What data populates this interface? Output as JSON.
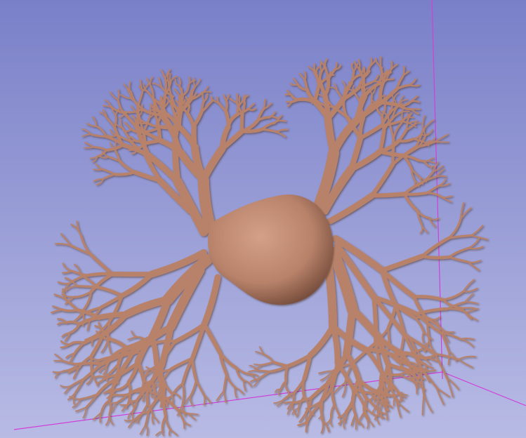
{
  "viewer": {
    "background_top": "#7A80C8",
    "background_bottom": "#B8BBE4",
    "bounding_box_color": "#D040D8"
  },
  "model": {
    "surface_color": "#B8826A",
    "highlight_color": "#D4A088",
    "shadow_color": "#5A3A2E"
  }
}
